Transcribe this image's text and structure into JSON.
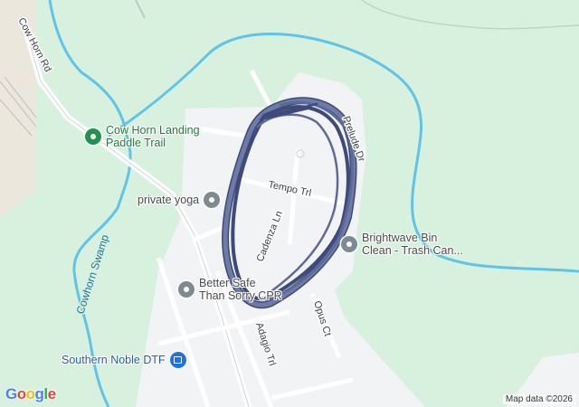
{
  "roads": {
    "cow_horn_rd": "Cow Horn Rd",
    "prelude_dr": "Prelude Dr",
    "tempo_trl": "Tempo Trl",
    "cadenza_ln": "Cadenza Ln",
    "opus_ct": "Opus Ct",
    "adagio_trl": "Adagio Trl"
  },
  "water": {
    "cowhorn_swamp": "Cowhorn Swamp"
  },
  "pois": [
    {
      "line1": "Cow Horn Landing",
      "line2": "Paddle Trail",
      "category": "park",
      "color": "#21924f",
      "icon": "park-pin-icon"
    },
    {
      "line1": "private yoga",
      "line2": "",
      "category": "business",
      "color": "#7b8a93",
      "icon": "place-pin-icon"
    },
    {
      "line1": "Brightwave Bin",
      "line2": "Clean - Trash Can...",
      "category": "business",
      "color": "#7b8a93",
      "icon": "place-pin-icon"
    },
    {
      "line1": "Better Safe",
      "line2": "Than Sorry CPR",
      "category": "business",
      "color": "#7b8a93",
      "icon": "place-pin-icon"
    },
    {
      "line1": "Southern Noble DTF",
      "line2": "",
      "category": "shopping",
      "color": "#1a73e8",
      "icon": "shopping-bag-pin-icon"
    }
  ],
  "route": {
    "color": "#5c6a96",
    "outline": "#3d4a7a"
  },
  "branding": {
    "logo": [
      "G",
      "o",
      "o",
      "g",
      "l",
      "e"
    ],
    "logo_colors": [
      "#4285f4",
      "#ea4335",
      "#fbbc05",
      "#4285f4",
      "#34a853",
      "#ea4335"
    ],
    "attribution": "Map data ©2026"
  }
}
